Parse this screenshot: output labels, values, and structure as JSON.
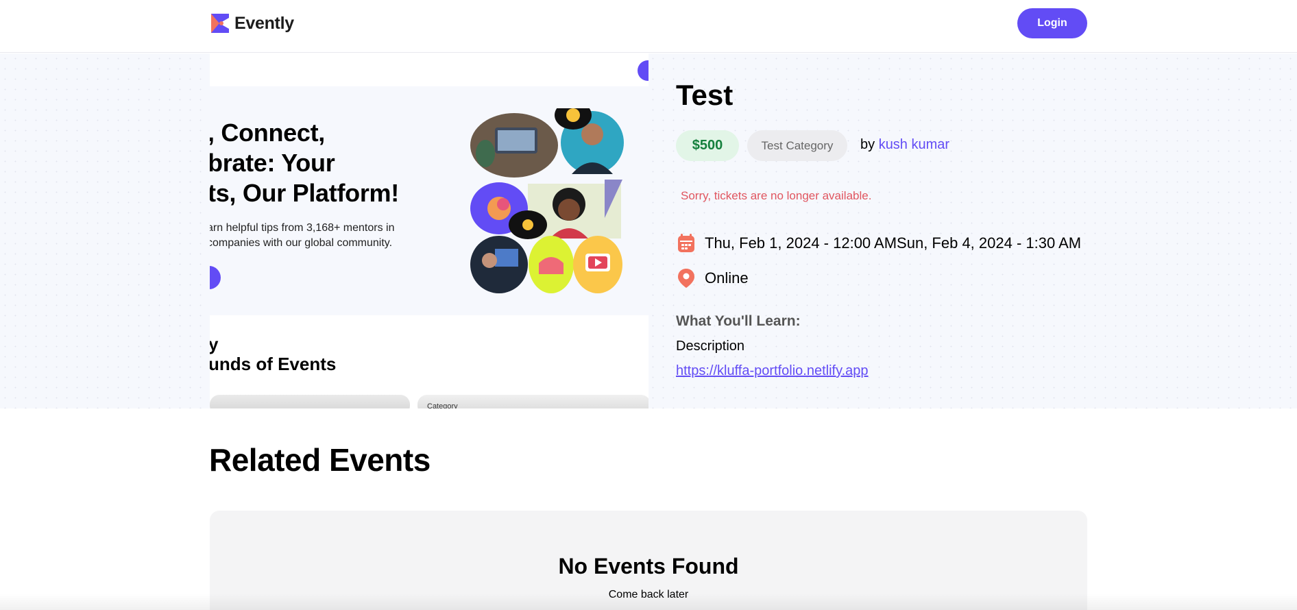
{
  "header": {
    "brand": "Evently",
    "login_label": "Login"
  },
  "event": {
    "title": "Test",
    "price": "$500",
    "category": "Test Category",
    "by_prefix": "by",
    "organizer": "kush kumar",
    "sold_out_message": "Sorry, tickets are no longer available.",
    "datetime": "Thu, Feb 1, 2024 - 12:00 AMSun, Feb 4, 2024 - 1:30 AM",
    "location": "Online",
    "learn_heading": "What You'll Learn:",
    "description": "Description",
    "url": "https://kluffa-portfolio.netlify.app"
  },
  "preview": {
    "headline_lines": [
      ", Connect,",
      "brate: Your",
      "ts, Our Platform!"
    ],
    "subtext_lines": [
      "arn helpful tips from 3,168+ mentors in",
      " companies with our global community."
    ],
    "section_lines": [
      "y",
      "unds of Events"
    ],
    "category_label": "Category"
  },
  "related": {
    "heading": "Related Events",
    "empty_title": "No Events Found",
    "empty_subtitle": "Come back later"
  },
  "colors": {
    "primary": "#624cf5",
    "price_bg": "#e2f5e7",
    "price_text": "#15803d",
    "error": "#e0555f",
    "icon_coral": "#f2725e"
  },
  "icons": {
    "calendar": "calendar-icon",
    "location": "location-pin-icon"
  }
}
